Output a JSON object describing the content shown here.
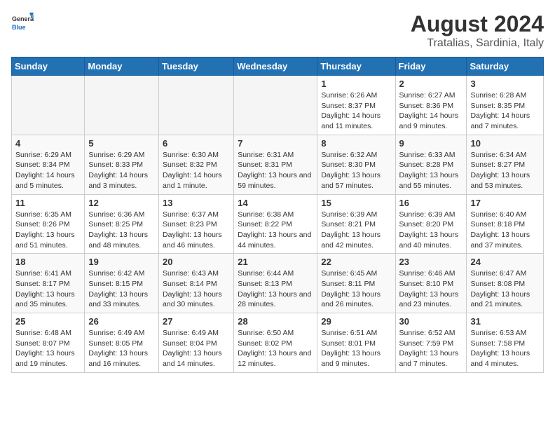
{
  "header": {
    "logo_general": "General",
    "logo_blue": "Blue",
    "title": "August 2024",
    "subtitle": "Tratalias, Sardinia, Italy"
  },
  "weekdays": [
    "Sunday",
    "Monday",
    "Tuesday",
    "Wednesday",
    "Thursday",
    "Friday",
    "Saturday"
  ],
  "weeks": [
    [
      {
        "day": "",
        "info": ""
      },
      {
        "day": "",
        "info": ""
      },
      {
        "day": "",
        "info": ""
      },
      {
        "day": "",
        "info": ""
      },
      {
        "day": "1",
        "info": "Sunrise: 6:26 AM\nSunset: 8:37 PM\nDaylight: 14 hours and 11 minutes."
      },
      {
        "day": "2",
        "info": "Sunrise: 6:27 AM\nSunset: 8:36 PM\nDaylight: 14 hours and 9 minutes."
      },
      {
        "day": "3",
        "info": "Sunrise: 6:28 AM\nSunset: 8:35 PM\nDaylight: 14 hours and 7 minutes."
      }
    ],
    [
      {
        "day": "4",
        "info": "Sunrise: 6:29 AM\nSunset: 8:34 PM\nDaylight: 14 hours and 5 minutes."
      },
      {
        "day": "5",
        "info": "Sunrise: 6:29 AM\nSunset: 8:33 PM\nDaylight: 14 hours and 3 minutes."
      },
      {
        "day": "6",
        "info": "Sunrise: 6:30 AM\nSunset: 8:32 PM\nDaylight: 14 hours and 1 minute."
      },
      {
        "day": "7",
        "info": "Sunrise: 6:31 AM\nSunset: 8:31 PM\nDaylight: 13 hours and 59 minutes."
      },
      {
        "day": "8",
        "info": "Sunrise: 6:32 AM\nSunset: 8:30 PM\nDaylight: 13 hours and 57 minutes."
      },
      {
        "day": "9",
        "info": "Sunrise: 6:33 AM\nSunset: 8:28 PM\nDaylight: 13 hours and 55 minutes."
      },
      {
        "day": "10",
        "info": "Sunrise: 6:34 AM\nSunset: 8:27 PM\nDaylight: 13 hours and 53 minutes."
      }
    ],
    [
      {
        "day": "11",
        "info": "Sunrise: 6:35 AM\nSunset: 8:26 PM\nDaylight: 13 hours and 51 minutes."
      },
      {
        "day": "12",
        "info": "Sunrise: 6:36 AM\nSunset: 8:25 PM\nDaylight: 13 hours and 48 minutes."
      },
      {
        "day": "13",
        "info": "Sunrise: 6:37 AM\nSunset: 8:23 PM\nDaylight: 13 hours and 46 minutes."
      },
      {
        "day": "14",
        "info": "Sunrise: 6:38 AM\nSunset: 8:22 PM\nDaylight: 13 hours and 44 minutes."
      },
      {
        "day": "15",
        "info": "Sunrise: 6:39 AM\nSunset: 8:21 PM\nDaylight: 13 hours and 42 minutes."
      },
      {
        "day": "16",
        "info": "Sunrise: 6:39 AM\nSunset: 8:20 PM\nDaylight: 13 hours and 40 minutes."
      },
      {
        "day": "17",
        "info": "Sunrise: 6:40 AM\nSunset: 8:18 PM\nDaylight: 13 hours and 37 minutes."
      }
    ],
    [
      {
        "day": "18",
        "info": "Sunrise: 6:41 AM\nSunset: 8:17 PM\nDaylight: 13 hours and 35 minutes."
      },
      {
        "day": "19",
        "info": "Sunrise: 6:42 AM\nSunset: 8:15 PM\nDaylight: 13 hours and 33 minutes."
      },
      {
        "day": "20",
        "info": "Sunrise: 6:43 AM\nSunset: 8:14 PM\nDaylight: 13 hours and 30 minutes."
      },
      {
        "day": "21",
        "info": "Sunrise: 6:44 AM\nSunset: 8:13 PM\nDaylight: 13 hours and 28 minutes."
      },
      {
        "day": "22",
        "info": "Sunrise: 6:45 AM\nSunset: 8:11 PM\nDaylight: 13 hours and 26 minutes."
      },
      {
        "day": "23",
        "info": "Sunrise: 6:46 AM\nSunset: 8:10 PM\nDaylight: 13 hours and 23 minutes."
      },
      {
        "day": "24",
        "info": "Sunrise: 6:47 AM\nSunset: 8:08 PM\nDaylight: 13 hours and 21 minutes."
      }
    ],
    [
      {
        "day": "25",
        "info": "Sunrise: 6:48 AM\nSunset: 8:07 PM\nDaylight: 13 hours and 19 minutes."
      },
      {
        "day": "26",
        "info": "Sunrise: 6:49 AM\nSunset: 8:05 PM\nDaylight: 13 hours and 16 minutes."
      },
      {
        "day": "27",
        "info": "Sunrise: 6:49 AM\nSunset: 8:04 PM\nDaylight: 13 hours and 14 minutes."
      },
      {
        "day": "28",
        "info": "Sunrise: 6:50 AM\nSunset: 8:02 PM\nDaylight: 13 hours and 12 minutes."
      },
      {
        "day": "29",
        "info": "Sunrise: 6:51 AM\nSunset: 8:01 PM\nDaylight: 13 hours and 9 minutes."
      },
      {
        "day": "30",
        "info": "Sunrise: 6:52 AM\nSunset: 7:59 PM\nDaylight: 13 hours and 7 minutes."
      },
      {
        "day": "31",
        "info": "Sunrise: 6:53 AM\nSunset: 7:58 PM\nDaylight: 13 hours and 4 minutes."
      }
    ]
  ]
}
